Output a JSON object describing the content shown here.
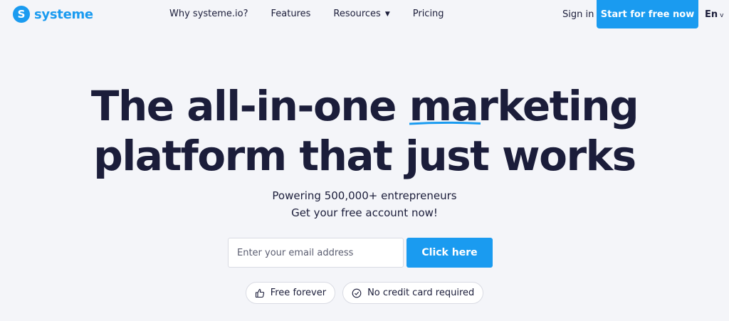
{
  "brand": {
    "name": "systeme",
    "mark": "S",
    "color": "#1a9bf0"
  },
  "nav": {
    "items": [
      {
        "label": "Why systeme.io?"
      },
      {
        "label": "Features"
      },
      {
        "label": "Resources"
      },
      {
        "label": "Pricing"
      }
    ],
    "sign_in": "Sign in",
    "cta": "Start for free now",
    "language": "En"
  },
  "hero": {
    "line1_a": "The all-in-one ",
    "line1_highlight": "marketing",
    "line2": "platform that just works",
    "sub1": "Powering 500,000+ entrepreneurs",
    "sub2": "Get your free account now!",
    "email_placeholder": "Enter your email address",
    "button": "Click here",
    "badges": [
      {
        "label": "Free forever",
        "icon": "thumbs-up-icon"
      },
      {
        "label": "No credit card required",
        "icon": "check-circle-icon"
      }
    ]
  },
  "colors": {
    "accent": "#1a9bf0",
    "text": "#1b1d3a",
    "background": "#f4f5f9"
  }
}
